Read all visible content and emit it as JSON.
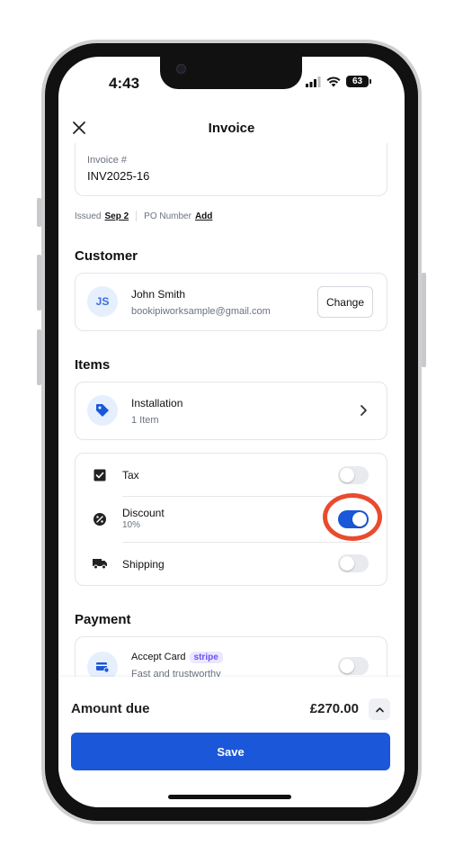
{
  "status_bar": {
    "time": "4:43",
    "battery": "63"
  },
  "header": {
    "title": "Invoice"
  },
  "invoice": {
    "number_label": "Invoice #",
    "number_value": "INV2025-16"
  },
  "meta": {
    "issued_label": "Issued",
    "issued_value": "Sep 2",
    "po_label": "PO Number",
    "po_value": "Add"
  },
  "customer": {
    "section_title": "Customer",
    "initials": "JS",
    "name": "John Smith",
    "email": "bookipiworksample@gmail.com",
    "change_label": "Change"
  },
  "items": {
    "section_title": "Items",
    "name": "Installation",
    "count": "1 Item"
  },
  "adjustments": {
    "tax": {
      "label": "Tax",
      "enabled": false
    },
    "discount": {
      "label": "Discount",
      "value": "10%",
      "enabled": true
    },
    "shipping": {
      "label": "Shipping",
      "enabled": false
    }
  },
  "payment": {
    "section_title": "Payment",
    "accept_card_label": "Accept Card",
    "stripe_badge": "stripe",
    "subtitle": "Fast and trustworthy",
    "enabled": false
  },
  "footer": {
    "amount_label": "Amount due",
    "amount_value": "£270.00",
    "save_label": "Save"
  },
  "colors": {
    "primary": "#1a57d9",
    "highlight": "#e94b2e",
    "stripe": "#6c4ff6"
  },
  "icons": {
    "close": "close-icon",
    "tag": "tag-icon",
    "chevron": "chevron-right-icon",
    "tax": "receipt-icon",
    "discount": "percent-icon",
    "shipping": "truck-icon",
    "card": "card-icon",
    "expand": "chevron-up-icon"
  }
}
